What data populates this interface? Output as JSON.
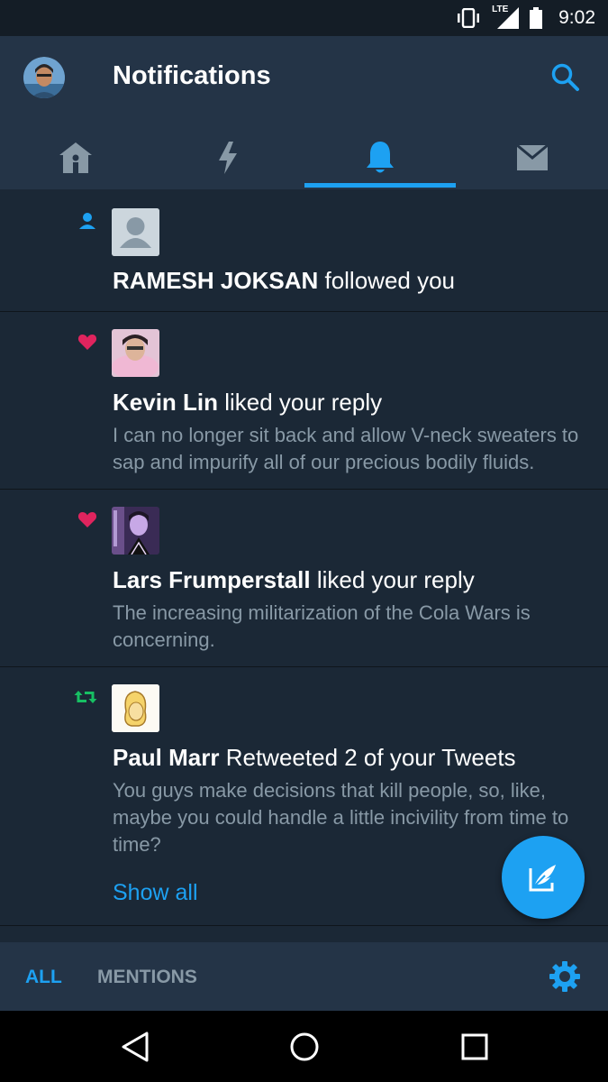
{
  "status_bar": {
    "network": "LTE",
    "time": "9:02"
  },
  "header": {
    "title": "Notifications"
  },
  "tabs": [
    {
      "name": "home",
      "icon": "home-icon",
      "active": false
    },
    {
      "name": "moments",
      "icon": "lightning-icon",
      "active": false
    },
    {
      "name": "notifications",
      "icon": "bell-icon",
      "active": true
    },
    {
      "name": "messages",
      "icon": "mail-icon",
      "active": false
    }
  ],
  "notifications": [
    {
      "type": "follow",
      "type_icon": "follow-person-icon",
      "user": "RAMESH JOKSAN",
      "action": " followed you",
      "snippet": ""
    },
    {
      "type": "like",
      "type_icon": "heart-icon",
      "user": "Kevin Lin",
      "action": " liked your reply",
      "snippet": "I can no longer sit back and allow V-neck sweaters to sap and impurify all of our precious bodily fluids."
    },
    {
      "type": "like",
      "type_icon": "heart-icon",
      "user": "Lars Frumperstall",
      "action": " liked your reply",
      "snippet": "The increasing militarization of the Cola Wars is concerning."
    },
    {
      "type": "retweet",
      "type_icon": "retweet-icon",
      "user": "Paul Marr",
      "action": " Retweeted 2 of your Tweets",
      "snippet": "You guys make decisions that kill people, so, like, maybe you could handle a little incivility from time to time?",
      "show_all": "Show all"
    }
  ],
  "bottom_bar": {
    "all_label": "ALL",
    "mentions_label": "MENTIONS"
  },
  "colors": {
    "accent": "#1da1f2",
    "like": "#e0245e",
    "retweet": "#17bf63",
    "muted": "#8899a6",
    "background": "#1b2836",
    "header": "#243447"
  }
}
